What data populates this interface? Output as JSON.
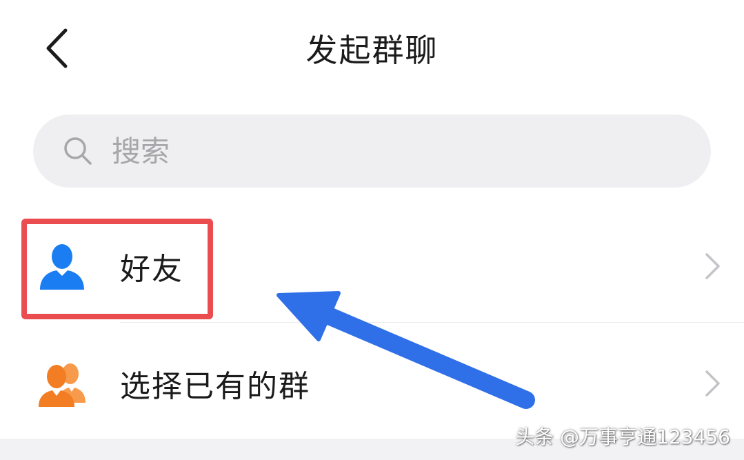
{
  "header": {
    "title": "发起群聊",
    "back_icon": "chevron-left-icon"
  },
  "search": {
    "placeholder": "搜索",
    "value": "",
    "icon": "search-icon"
  },
  "list": {
    "items": [
      {
        "label": "好友",
        "icon": "person-icon",
        "icon_color": "#1a7ef2",
        "chevron": "chevron-right-icon"
      },
      {
        "label": "选择已有的群",
        "icon": "group-icon",
        "icon_color": "#f27d22",
        "chevron": "chevron-right-icon"
      }
    ]
  },
  "annotation": {
    "highlight_color": "#ea4c4f",
    "arrow_color": "#2f6fe8"
  },
  "watermark": {
    "text": "头条 @万事亨通123456"
  }
}
